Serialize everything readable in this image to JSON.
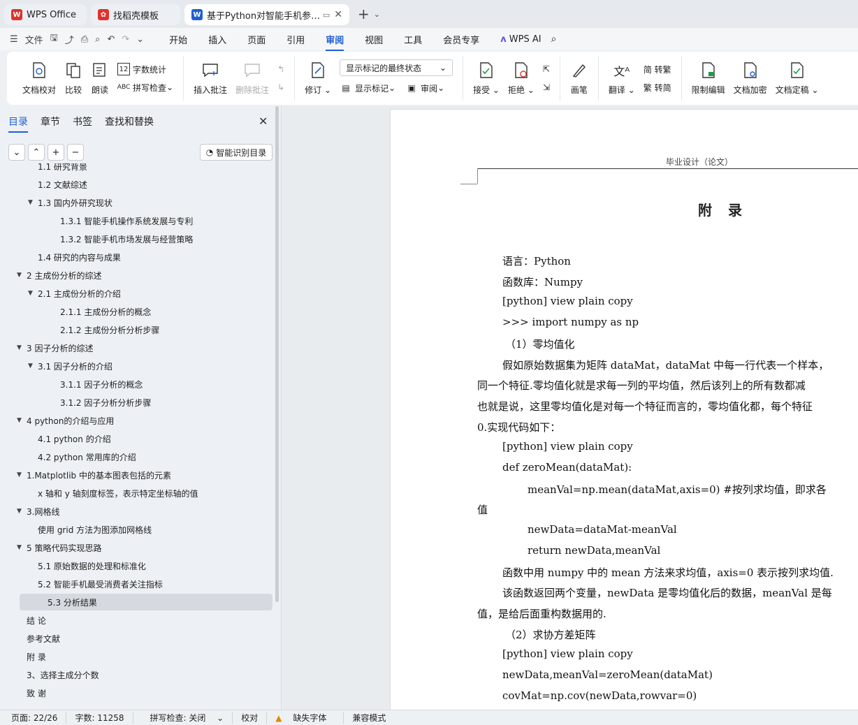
{
  "tabs": [
    {
      "label": "WPS Office"
    },
    {
      "label": "找稻壳模板"
    },
    {
      "label": "基于Python对智能手机参数对"
    }
  ],
  "menu": {
    "file": "文件",
    "items": [
      "开始",
      "插入",
      "页面",
      "引用",
      "审阅",
      "视图",
      "工具",
      "会员专享"
    ],
    "active": "审阅",
    "wps_ai": "WPS AI"
  },
  "ribbon": {
    "proofread": "文档校对",
    "compare": "比较",
    "read_aloud": "朗读",
    "word_count": "字数统计",
    "spell_check": "拼写检查",
    "insert_comment": "插入批注",
    "delete_comment": "删除批注",
    "revise": "修订",
    "markup_state": "显示标记的最终状态",
    "show_markup": "显示标记",
    "review": "审阅",
    "accept": "接受",
    "reject": "拒绝",
    "pen": "画笔",
    "translate": "翻译",
    "to_traditional": "简 转繁",
    "to_simplified": "繁 转简",
    "restrict_edit": "限制编辑",
    "encrypt": "文档加密",
    "finalize": "文档定稿"
  },
  "panel": {
    "tabs": [
      "目录",
      "章节",
      "书签",
      "查找和替换"
    ],
    "active_tab": "目录",
    "smart_toc": "智能识别目录",
    "toc": [
      {
        "label": "1.1 研究背景",
        "level": 2,
        "arrow": ""
      },
      {
        "label": "1.2 文献综述",
        "level": 2,
        "arrow": ""
      },
      {
        "label": "1.3 国内外研究现状",
        "level": 2,
        "arrow": "▼"
      },
      {
        "label": "1.3.1 智能手机操作系统发展与专利",
        "level": 3,
        "arrow": ""
      },
      {
        "label": "1.3.2 智能手机市场发展与经营策略",
        "level": 3,
        "arrow": ""
      },
      {
        "label": "1.4  研究的内容与成果",
        "level": 2,
        "arrow": ""
      },
      {
        "label": "2 主成份分析的综述",
        "level": 1,
        "arrow": "▼"
      },
      {
        "label": "2.1 主成份分析的介绍",
        "level": 2,
        "arrow": "▼"
      },
      {
        "label": "2.1.1 主成份分析的概念",
        "level": 3,
        "arrow": ""
      },
      {
        "label": "2.1.2 主成份分析分析步骤",
        "level": 3,
        "arrow": ""
      },
      {
        "label": "3  因子分析的综述",
        "level": 1,
        "arrow": "▼"
      },
      {
        "label": "3.1  因子分析的介绍",
        "level": 2,
        "arrow": "▼"
      },
      {
        "label": "3.1.1  因子分析的概念",
        "level": 3,
        "arrow": ""
      },
      {
        "label": "3.1.2 因子分析分析步骤",
        "level": 3,
        "arrow": ""
      },
      {
        "label": "4 python的介绍与应用",
        "level": 1,
        "arrow": "▼"
      },
      {
        "label": "4.1 python 的介绍",
        "level": 2,
        "arrow": ""
      },
      {
        "label": "4.2 python 常用库的介绍",
        "level": 2,
        "arrow": ""
      },
      {
        "label": "1.Matplotlib 中的基本图表包括的元素",
        "level": 1,
        "arrow": "▼"
      },
      {
        "label": "x 轴和 y 轴刻度标签，表示特定坐标轴的值",
        "level": 2,
        "arrow": ""
      },
      {
        "label": "3.网格线",
        "level": 1,
        "arrow": "▼"
      },
      {
        "label": "使用 grid 方法为图添加网格线",
        "level": 2,
        "arrow": ""
      },
      {
        "label": "5 策略代码实现思路",
        "level": 1,
        "arrow": "▼"
      },
      {
        "label": "5.1  原始数据的处理和标准化",
        "level": 2,
        "arrow": ""
      },
      {
        "label": "5.2  智能手机最受消费者关注指标",
        "level": 2,
        "arrow": ""
      },
      {
        "label": "5.3  分析结果",
        "level": 2,
        "arrow": "",
        "selected": true
      },
      {
        "label": "结  论",
        "level": 1,
        "arrow": ""
      },
      {
        "label": "参考文献",
        "level": 1,
        "arrow": ""
      },
      {
        "label": "附  录",
        "level": 1,
        "arrow": ""
      },
      {
        "label": "3、选择主成分个数",
        "level": 1,
        "arrow": ""
      },
      {
        "label": "致  谢",
        "level": 1,
        "arrow": ""
      }
    ]
  },
  "document": {
    "header": "毕业设计（论文）",
    "title": "附 录",
    "lines": [
      "语言：Python",
      "函数库：Numpy",
      "[python] view plain copy",
      ">>> import numpy as np",
      "（1）零均值化",
      "假如原始数据集为矩阵 dataMat，dataMat 中每一行代表一个样本，",
      "同一个特征.零均值化就是求每一列的平均值，然后该列上的所有数都减",
      "也就是说，这里零均值化是对每一个特征而言的，零均值化都，每个特征",
      "0.实现代码如下：",
      "[python] view plain copy",
      "def zeroMean(dataMat):",
      "meanVal=np.mean(dataMat,axis=0)     #按列求均值，即求各",
      "值",
      "newData=dataMat-meanVal",
      "return newData,meanVal",
      "函数中用 numpy 中的 mean 方法来求均值，axis=0 表示按列求均值.",
      "该函数返回两个变量，newData 是零均值化后的数据，meanVal 是每",
      "值，是给后面重构数据用的.",
      "（2）求协方差矩阵",
      "[python] view plain copy",
      "newData,meanVal=zeroMean(dataMat)",
      "covMat=np.cov(newData,rowvar=0)"
    ]
  },
  "status": {
    "page": "页面: 22/26",
    "words": "字数: 11258",
    "spell": "拼写检查: 关闭",
    "proof": "校对",
    "missing_font": "缺失字体",
    "compat": "兼容模式"
  },
  "colors": {
    "accent": "#1f5ed3",
    "wps_red": "#e0322b"
  }
}
